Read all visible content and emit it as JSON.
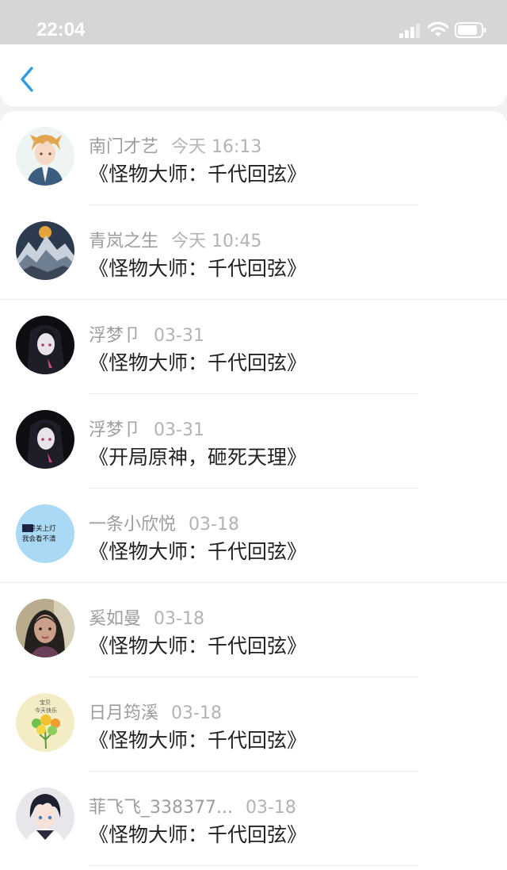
{
  "status_bar": {
    "time": "22:04",
    "icons": [
      "signal-icon",
      "wifi-icon",
      "battery-icon"
    ]
  },
  "nav": {
    "back_icon": "chevron-left-icon"
  },
  "accent_color": "#2d9de8",
  "comments": [
    {
      "author": "南门才艺",
      "date": "今天 16:13",
      "book": "《怪物大师：千代回弦》",
      "avatar": "anime-blond-boy"
    },
    {
      "author": "青岚之生",
      "date": "今天 10:45",
      "book": "《怪物大师：千代回弦》",
      "avatar": "mountain-landscape"
    },
    {
      "author": "浮梦卩",
      "date": "03-31",
      "book": "《怪物大师：千代回弦》",
      "avatar": "dark-anime-girl"
    },
    {
      "author": "浮梦卩",
      "date": "03-31",
      "book": "《开局原神，砸死天理》",
      "avatar": "dark-anime-girl"
    },
    {
      "author": "一条小欣悦",
      "date": "03-18",
      "book": "《怪物大师：千代回弦》",
      "avatar": "text-sticker",
      "avatar_text": [
        "如果关上灯",
        "我会看不清"
      ]
    },
    {
      "author": "奚如曼",
      "date": "03-18",
      "book": "《怪物大师：千代回弦》",
      "avatar": "portrait-photo"
    },
    {
      "author": "日月筠溪",
      "date": "03-18",
      "book": "《怪物大师：千代回弦》",
      "avatar": "flower-doodle",
      "avatar_text": [
        "宝贝",
        "今天快乐"
      ]
    },
    {
      "author": "菲飞飞_338377...",
      "date": "03-18",
      "book": "《怪物大师：千代回弦》",
      "avatar": "anime-dark-hair-boy"
    }
  ]
}
